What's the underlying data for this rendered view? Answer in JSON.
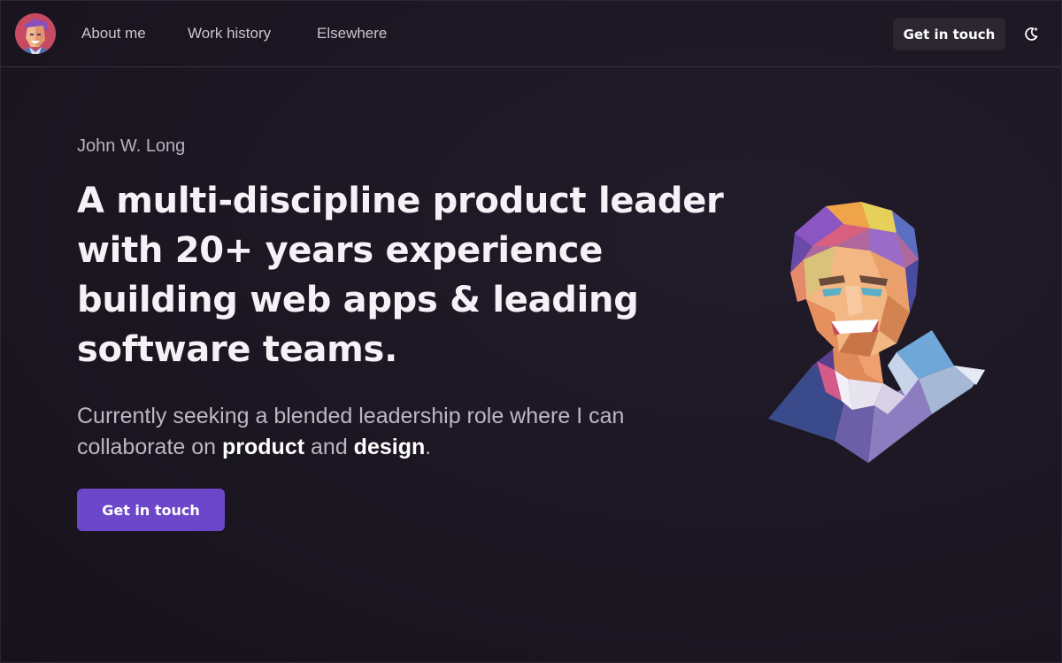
{
  "nav": {
    "avatar_alt": "John W. Long avatar",
    "links": [
      {
        "label": "About me"
      },
      {
        "label": "Work history"
      },
      {
        "label": "Elsewhere"
      }
    ],
    "cta_label": "Get in touch",
    "theme_toggle_icon": "moon-sparkle-icon"
  },
  "hero": {
    "eyebrow": "John W. Long",
    "headline_lines": [
      "A multi-discipline product leader",
      "with 20+ years experience",
      "building web apps & leading",
      "software teams."
    ],
    "lede": {
      "line1": "Currently seeking a blended leadership role where I can",
      "line2_prefix": "collaborate on ",
      "emphasis_1": "product",
      "connector": " and ",
      "emphasis_2": "design",
      "suffix": "."
    },
    "cta_label": "Get in touch",
    "portrait_icon": "polygon-portrait-illustration"
  },
  "colors": {
    "background": "#1a1520",
    "accent": "#6d47c9",
    "nav_button": "#2b2630",
    "muted_text": "#bdb7c4"
  }
}
